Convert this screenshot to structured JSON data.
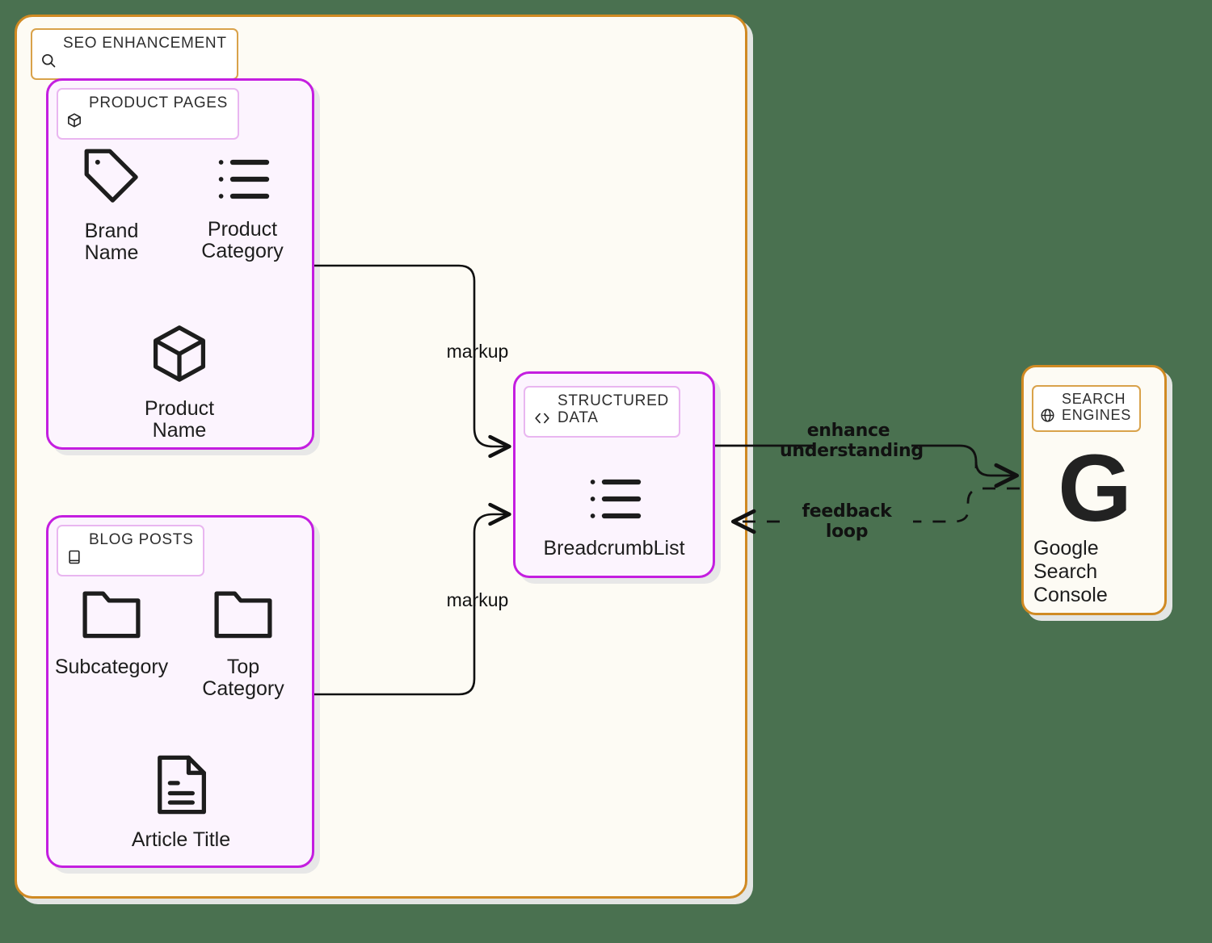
{
  "diagram": {
    "background_color": "#4a7150",
    "accent_orange": "#d08a23",
    "accent_purple": "#c41ee0",
    "root": {
      "badge_label": "SEO ENHANCEMENT",
      "badge_icon": "search-icon"
    },
    "groups": [
      {
        "id": "product-pages",
        "badge_label": "PRODUCT PAGES",
        "badge_icon": "package-icon",
        "nodes": [
          {
            "id": "brand-name",
            "label": "Brand Name",
            "icon": "tag-icon"
          },
          {
            "id": "product-category",
            "label": "Product\nCategory",
            "icon": "list-icon"
          },
          {
            "id": "product-name",
            "label": "Product\nName",
            "icon": "cube-icon"
          }
        ]
      },
      {
        "id": "blog-posts",
        "badge_label": "BLOG POSTS",
        "badge_icon": "book-icon",
        "nodes": [
          {
            "id": "subcategory",
            "label": "Subcategory",
            "icon": "folder-icon"
          },
          {
            "id": "top-category",
            "label": "Top\nCategory",
            "icon": "folder-icon"
          },
          {
            "id": "article-title",
            "label": "Article Title",
            "icon": "document-icon"
          }
        ]
      },
      {
        "id": "structured-data",
        "badge_label": "STRUCTURED\nDATA",
        "badge_icon": "code-brackets-icon",
        "nodes": [
          {
            "id": "breadcrumb-list",
            "label": "BreadcrumbList",
            "icon": "list-icon"
          }
        ]
      },
      {
        "id": "search-engines",
        "badge_label": "SEARCH\nENGINES",
        "badge_icon": "globe-icon",
        "nodes": [
          {
            "id": "google-search-console",
            "label": "Google\nSearch\nConsole",
            "icon": "google-g-icon",
            "glyph": "G"
          }
        ]
      }
    ],
    "edges": [
      {
        "id": "product-to-structured",
        "label": "markup",
        "from": "product-pages",
        "to": "structured-data",
        "style": "solid"
      },
      {
        "id": "blog-to-structured",
        "label": "markup",
        "from": "blog-posts",
        "to": "structured-data",
        "style": "solid"
      },
      {
        "id": "structured-to-search",
        "label": "enhance\nunderstanding",
        "from": "structured-data",
        "to": "search-engines",
        "style": "solid"
      },
      {
        "id": "search-to-structured",
        "label": "feedback loop",
        "from": "search-engines",
        "to": "structured-data",
        "style": "dashed"
      }
    ]
  }
}
